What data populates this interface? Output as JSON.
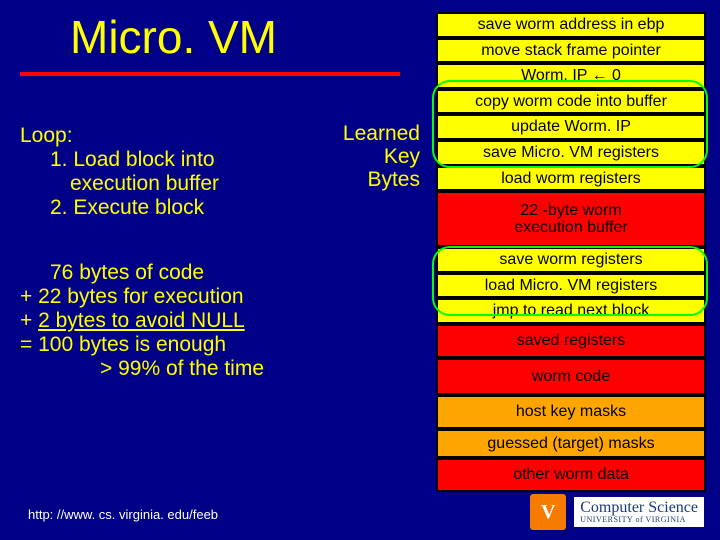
{
  "title": "Micro. VM",
  "learned": {
    "l1": "Learned",
    "l2": "Key",
    "l3": "Bytes"
  },
  "loop": {
    "label": "Loop:",
    "step1a": "1. Load block into",
    "step1b": "execution buffer",
    "step2": "2. Execute block"
  },
  "calc": {
    "l1": "76 bytes of code",
    "l2": "+  22 bytes for execution",
    "l3_prefix": "+    ",
    "l3_underlined": "2 bytes to avoid NULL",
    "l4": "= 100 bytes is enough",
    "l5": "> 99% of the time"
  },
  "boxes": {
    "b1": "save worm address in ebp",
    "b2": "move stack frame pointer",
    "b3": "Worm. IP ← 0",
    "b4": "copy worm code into buffer",
    "b5": "update Worm. IP",
    "b6": "save Micro. VM registers",
    "b7": "load worm registers",
    "buffer_l1": "22 -byte worm",
    "buffer_l2": "execution buffer",
    "b8": "save worm registers",
    "b9": "load Micro. VM registers",
    "b10": "jmp to read next block",
    "b11": "saved registers",
    "b12": "worm code",
    "b13": "host key masks",
    "b14": "guessed (target) masks",
    "b15": "other worm data"
  },
  "footer": "http: //www. cs. virginia. edu/feeb",
  "logo": {
    "v": "V",
    "cs": "Computer Science",
    "uni": "UNIVERSITY of VIRGINIA"
  }
}
